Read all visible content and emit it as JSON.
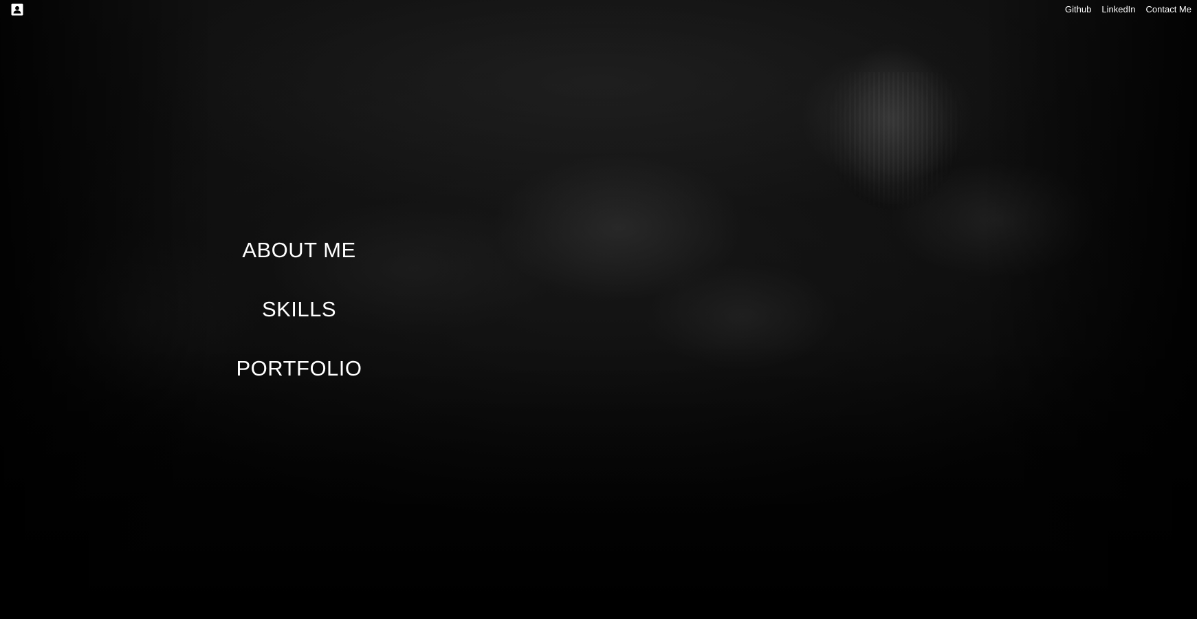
{
  "header": {
    "logo_icon": "contact-card-icon",
    "links": [
      {
        "label": "Github"
      },
      {
        "label": "LinkedIn"
      },
      {
        "label": "Contact Me"
      }
    ]
  },
  "menu": {
    "items": [
      {
        "label": "ABOUT ME"
      },
      {
        "label": "SKILLS"
      },
      {
        "label": "PORTFOLIO"
      }
    ]
  },
  "colors": {
    "text": "#ffffff",
    "background": "#000000"
  }
}
